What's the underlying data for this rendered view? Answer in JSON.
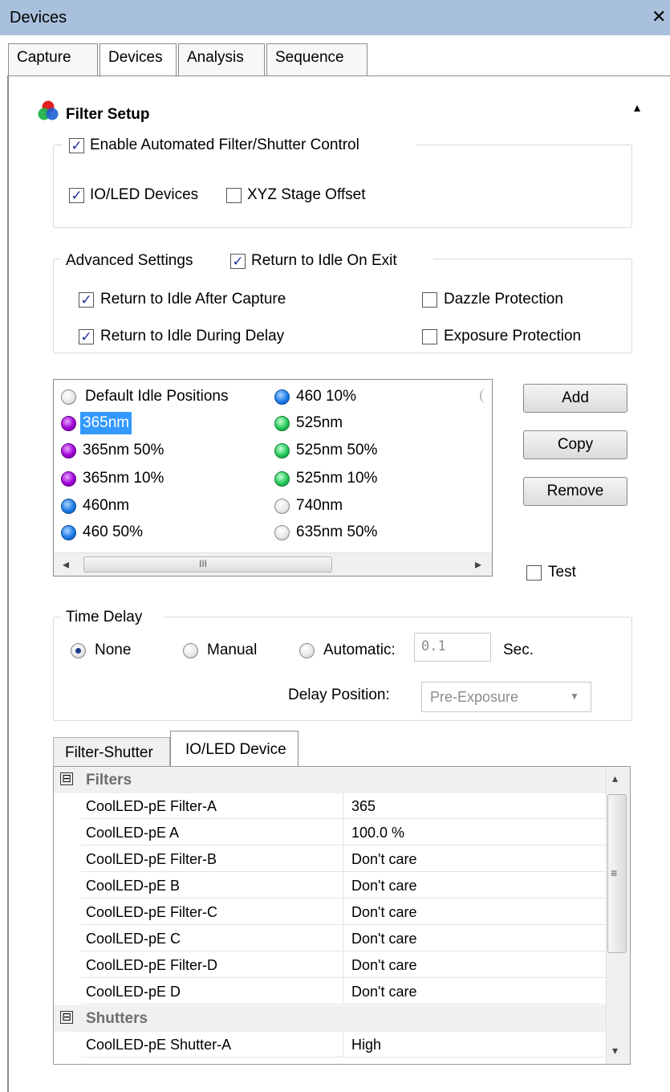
{
  "window": {
    "title": "Devices",
    "close": "✕"
  },
  "tabs": [
    {
      "label": "Capture"
    },
    {
      "label": "Devices"
    },
    {
      "label": "Analysis"
    },
    {
      "label": "Sequence"
    }
  ],
  "filter_setup": {
    "title": "Filter Setup",
    "collapse": "▴",
    "enable_automated": {
      "label": "Enable Automated Filter/Shutter Control",
      "checked": true
    },
    "io_led_devices": {
      "label": "IO/LED Devices",
      "checked": true
    },
    "xyz_stage_offset": {
      "label": "XYZ Stage Offset",
      "checked": false
    }
  },
  "advanced": {
    "title": "Advanced Settings",
    "return_idle_exit": {
      "label": "Return to Idle On Exit",
      "checked": true
    },
    "return_idle_capture": {
      "label": "Return to Idle After Capture",
      "checked": true
    },
    "return_idle_delay": {
      "label": "Return to Idle During Delay",
      "checked": true
    },
    "dazzle": {
      "label": "Dazzle Protection",
      "checked": false
    },
    "exposure": {
      "label": "Exposure Protection",
      "checked": false
    }
  },
  "positions": {
    "col1": [
      {
        "label": "Default Idle Positions",
        "color": "gray"
      },
      {
        "label": "365nm",
        "color": "purple",
        "selected": true
      },
      {
        "label": "365nm 50%",
        "color": "purple"
      },
      {
        "label": "365nm 10%",
        "color": "purple"
      },
      {
        "label": "460nm",
        "color": "blue"
      },
      {
        "label": "460 50%",
        "color": "blue"
      }
    ],
    "col2": [
      {
        "label": "460 10%",
        "color": "blue"
      },
      {
        "label": "525nm",
        "color": "green"
      },
      {
        "label": "525nm 50%",
        "color": "green"
      },
      {
        "label": "525nm 10%",
        "color": "green"
      },
      {
        "label": "740nm",
        "color": "gray"
      },
      {
        "label": "635nm 50%",
        "color": "gray"
      }
    ],
    "scroll_left": "◂",
    "scroll_right": "▸",
    "scroll_grip": "III"
  },
  "buttons": {
    "add": "Add",
    "copy": "Copy",
    "remove": "Remove"
  },
  "test": {
    "label": "Test",
    "checked": false
  },
  "time_delay": {
    "title": "Time Delay",
    "none": "None",
    "manual": "Manual",
    "automatic": "Automatic:",
    "value": "0.1",
    "unit": "Sec.",
    "delay_position_label": "Delay Position:",
    "delay_position_value": "Pre-Exposure"
  },
  "sub_tabs": [
    {
      "label": "Filter-Shutter"
    },
    {
      "label": "IO/LED Device"
    }
  ],
  "grid": {
    "categories": [
      {
        "name": "Filters",
        "rows": [
          {
            "name": "CoolLED-pE Filter-A",
            "value": "365"
          },
          {
            "name": "CoolLED-pE A",
            "value": "100.0 %"
          },
          {
            "name": "CoolLED-pE Filter-B",
            "value": "Don't care"
          },
          {
            "name": "CoolLED-pE B",
            "value": "Don't care"
          },
          {
            "name": "CoolLED-pE Filter-C",
            "value": "Don't care"
          },
          {
            "name": "CoolLED-pE C",
            "value": "Don't care"
          },
          {
            "name": "CoolLED-pE Filter-D",
            "value": "Don't care"
          },
          {
            "name": "CoolLED-pE D",
            "value": "Don't care"
          }
        ]
      },
      {
        "name": "Shutters",
        "rows": [
          {
            "name": "CoolLED-pE Shutter-A",
            "value": "High"
          }
        ]
      }
    ],
    "toggle": "⊟",
    "scroll_up": "▴",
    "scroll_down": "▾",
    "scroll_grip": "≡"
  },
  "colors": {
    "titlebar": "#a9c0dd",
    "selection": "#3399ff",
    "checkmark": "#1b2f9e"
  }
}
